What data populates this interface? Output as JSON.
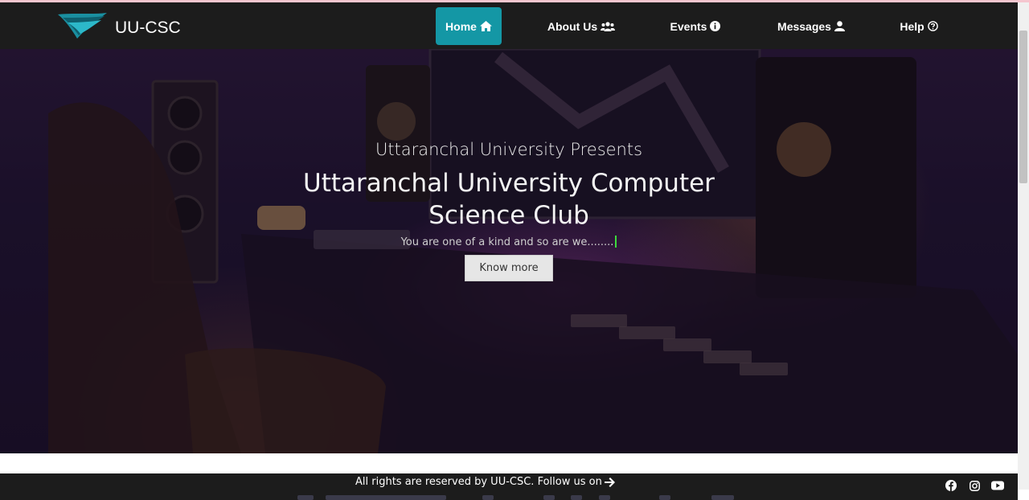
{
  "brand": {
    "name": "UU-CSC",
    "logo_icon": "wing-logo-icon",
    "accent_color": "#1497a5"
  },
  "nav": {
    "items": [
      {
        "label": "Home",
        "icon": "home-icon",
        "active": true
      },
      {
        "label": "About Us",
        "icon": "users-icon",
        "active": false
      },
      {
        "label": "Events",
        "icon": "info-circle-icon",
        "active": false
      },
      {
        "label": "Messages",
        "icon": "user-icon",
        "active": false
      },
      {
        "label": "Help",
        "icon": "question-circle-icon",
        "active": false
      }
    ]
  },
  "hero": {
    "subtitle": "Uttaranchal University Presents",
    "title": "Uttaranchal University Computer Science Club",
    "tagline": "You are one of a kind and so are we........",
    "button_label": "Know more"
  },
  "footer": {
    "text": "All rights are reserved by UU-CSC. Follow us on",
    "social": [
      "facebook-icon",
      "instagram-icon",
      "youtube-icon"
    ]
  }
}
